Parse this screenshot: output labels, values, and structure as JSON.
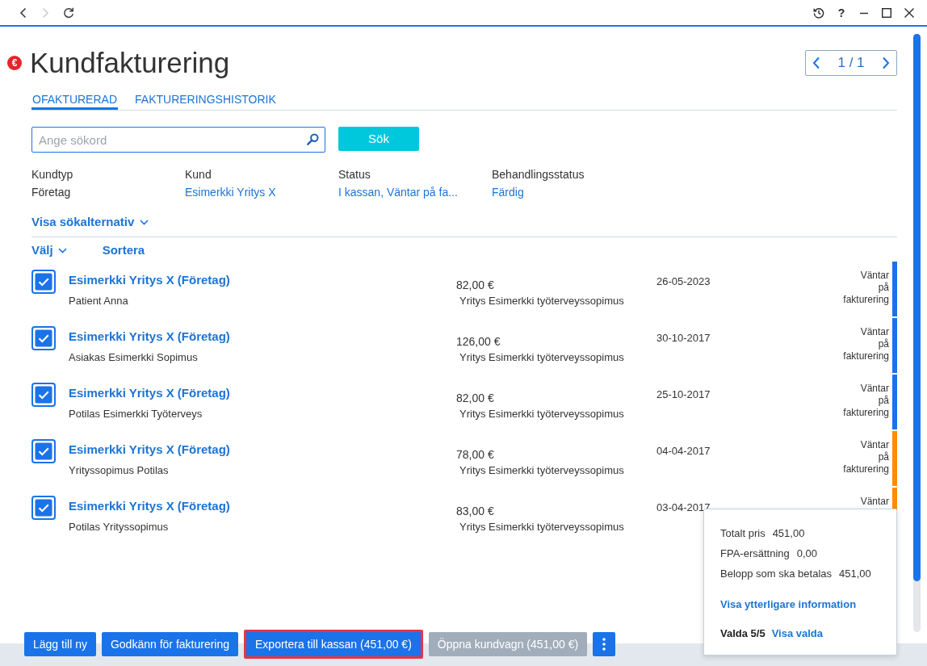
{
  "toolbar": {
    "nav": [
      {
        "kind": "back",
        "disabled": false
      },
      {
        "kind": "forward",
        "disabled": true
      },
      {
        "kind": "refresh",
        "disabled": false
      }
    ],
    "window_controls": [
      {
        "kind": "history"
      },
      {
        "kind": "help",
        "label": "?"
      },
      {
        "kind": "minimize"
      },
      {
        "kind": "maximize"
      },
      {
        "kind": "close"
      }
    ]
  },
  "header": {
    "badge": "€",
    "title": "Kundfakturering",
    "pager": "1 / 1"
  },
  "tabs": [
    {
      "label": "OFAKTURERAD",
      "selected": true
    },
    {
      "label": "FAKTURERINGSHISTORIK",
      "selected": false
    }
  ],
  "search": {
    "placeholder": "Ange sökord",
    "button": "Sök"
  },
  "filters": [
    {
      "label": "Kundtyp",
      "value": "Företag",
      "link": false
    },
    {
      "label": "Kund",
      "value": "Esimerkki Yritys X",
      "link": true
    },
    {
      "label": "Status",
      "value": "I kassan, Väntar på fa...",
      "link": true
    },
    {
      "label": "Behandlingsstatus",
      "value": "Färdig",
      "link": true
    }
  ],
  "search_options_toggle": "Visa sökalternativ",
  "list_actions": {
    "select": "Välj",
    "sort": "Sortera"
  },
  "invoices": [
    {
      "customer": "Esimerkki Yritys X (Företag)",
      "patient": "Patient Anna",
      "amount": "82,00 €",
      "contract": "Yritys Esimerkki työterveyssopimus",
      "date": "26-05-2023",
      "status": "Väntar på fakturering",
      "color": "#1a73e8",
      "checked": true
    },
    {
      "customer": "Esimerkki Yritys X (Företag)",
      "patient": "Asiakas Esimerkki Sopimus",
      "amount": "126,00 €",
      "contract": "Yritys Esimerkki työterveyssopimus",
      "date": "30-10-2017",
      "status": "Väntar på fakturering",
      "color": "#1a73e8",
      "checked": true
    },
    {
      "customer": "Esimerkki Yritys X (Företag)",
      "patient": "Potilas Esimerkki Työterveys",
      "amount": "82,00 €",
      "contract": "Yritys Esimerkki työterveyssopimus",
      "date": "25-10-2017",
      "status": "Väntar på fakturering",
      "color": "#1a73e8",
      "checked": true
    },
    {
      "customer": "Esimerkki Yritys X (Företag)",
      "patient": "Yrityssopimus Potilas",
      "amount": "78,00 €",
      "contract": "Yritys Esimerkki työterveyssopimus",
      "date": "04-04-2017",
      "status": "Väntar på fakturering",
      "color": "#ff8c00",
      "checked": true
    },
    {
      "customer": "Esimerkki Yritys X (Företag)",
      "patient": "Potilas Yrityssopimus",
      "amount": "83,00 €",
      "contract": "Yritys Esimerkki työterveyssopimus",
      "date": "03-04-2017",
      "status": "Väntar",
      "color": "#ff8c00",
      "checked": true
    }
  ],
  "summary_popup": {
    "lines": [
      {
        "label": "Totalt pris",
        "value": "451,00"
      },
      {
        "label": "FPA-ersättning",
        "value": "0,00"
      },
      {
        "label": "Belopp som ska betalas",
        "value": "451,00"
      }
    ],
    "more_link": "Visa ytterligare information",
    "selected_count": "Valda 5/5",
    "show_selected_link": "Visa valda"
  },
  "actions": [
    {
      "label": "Lägg till ny",
      "disabled": false,
      "highlighted": false
    },
    {
      "label": "Godkänn för fakturering",
      "disabled": false,
      "highlighted": false
    },
    {
      "label": "Exportera till kassan (451,00 €)",
      "disabled": false,
      "highlighted": true
    },
    {
      "label": "Öppna kundvagn (451,00 €)",
      "disabled": true,
      "highlighted": false
    }
  ]
}
